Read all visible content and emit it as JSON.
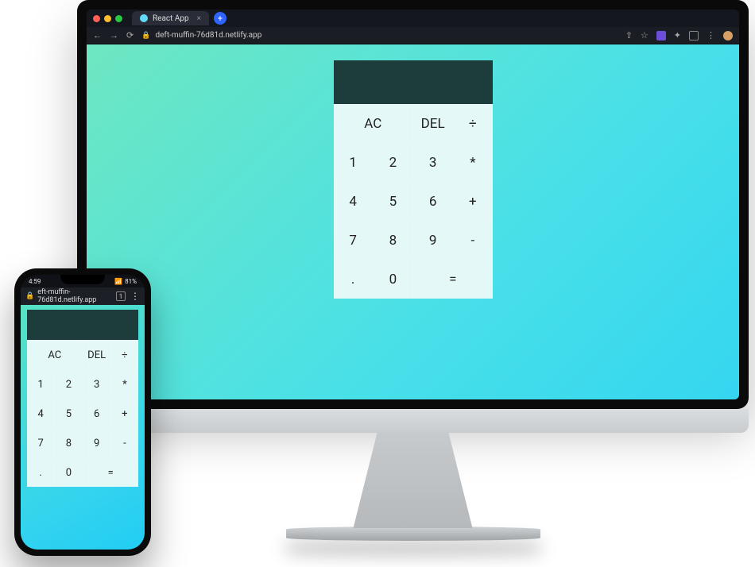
{
  "browser": {
    "tab_title": "React App",
    "url": "deft-muffin-76d81d.netlify.app",
    "new_tab_glyph": "+",
    "nav": {
      "back": "←",
      "forward": "→",
      "reload": "⟳"
    },
    "right": {
      "share": "⇧",
      "star": "☆",
      "puzzle": "✦",
      "menu": "⋮"
    }
  },
  "phone": {
    "time": "4:59",
    "status_right": "81%",
    "url": "eft-muffin-76d81d.netlify.app",
    "tab_count": "1",
    "menu": "⋮"
  },
  "calculator": {
    "display": "",
    "buttons": {
      "ac": "AC",
      "del": "DEL",
      "divide": "÷",
      "multiply": "*",
      "add": "+",
      "subtract": "-",
      "equals": "=",
      "decimal": ".",
      "n0": "0",
      "n1": "1",
      "n2": "2",
      "n3": "3",
      "n4": "4",
      "n5": "5",
      "n6": "6",
      "n7": "7",
      "n8": "8",
      "n9": "9"
    }
  }
}
